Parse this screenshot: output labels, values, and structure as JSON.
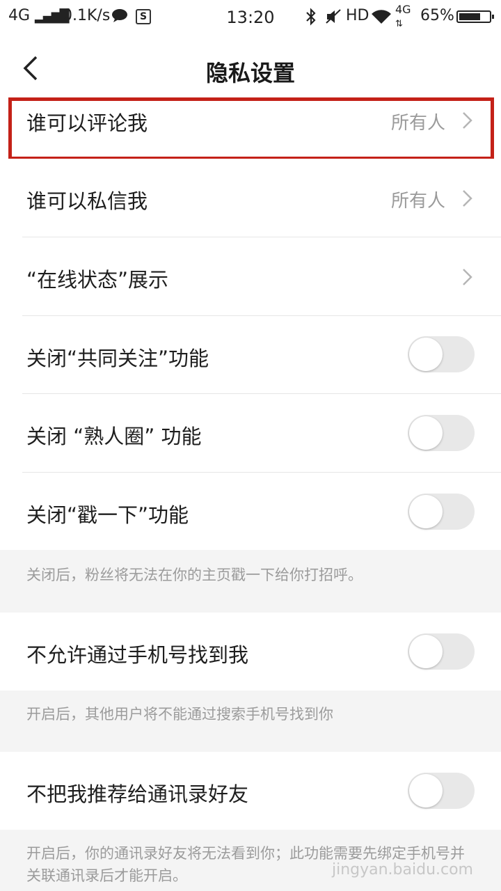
{
  "status_bar": {
    "network": "4G",
    "speed": "0.1K/s",
    "time": "13:20",
    "hd": "HD",
    "network2": "4G",
    "battery": "65%"
  },
  "header": {
    "title": "隐私设置"
  },
  "rows": {
    "comment": {
      "label": "谁可以评论我",
      "value": "所有人"
    },
    "message": {
      "label": "谁可以私信我",
      "value": "所有人"
    },
    "online": {
      "label": "“在线状态”展示"
    },
    "mutual": {
      "label": "关闭“共同关注”功能",
      "enabled": false
    },
    "acquaintance": {
      "label": "关闭 “熟人圈” 功能",
      "enabled": false
    },
    "poke": {
      "label": "关闭“戳一下”功能",
      "enabled": false
    },
    "phone": {
      "label": "不允许通过手机号找到我",
      "enabled": false
    },
    "contacts": {
      "label": "不把我推荐给通讯录好友",
      "enabled": false
    }
  },
  "notes": {
    "poke": "关闭后，粉丝将无法在你的主页戳一下给你打招呼。",
    "phone": "开启后，其他用户将不能通过搜索手机号找到你",
    "contacts": "开启后，你的通讯录好友将无法看到你；此功能需要先绑定手机号并关联通讯录后才能开启。"
  },
  "watermark": "jingyan.baidu.com",
  "colors": {
    "highlight": "#c42118",
    "note_bg": "#f4f4f4",
    "toggle_off": "#e8e8e8"
  }
}
